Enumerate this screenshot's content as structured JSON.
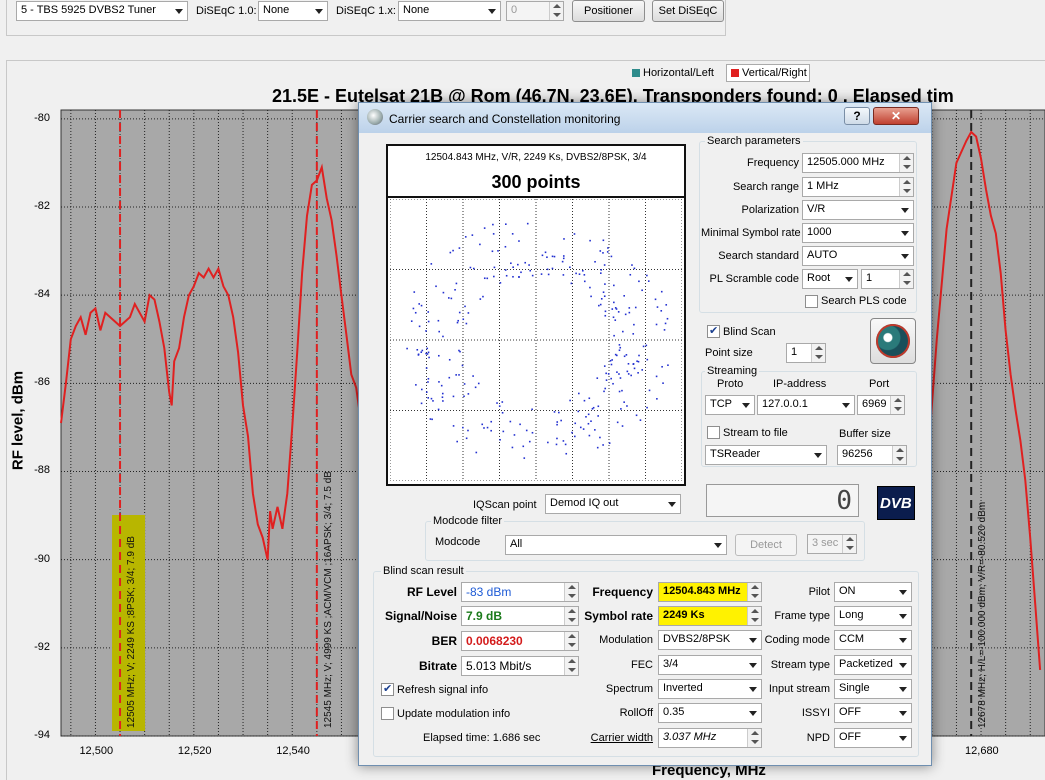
{
  "toolbar": {
    "tuner": "5 - TBS 5925 DVBS2 Tuner",
    "diseqc10_label": "DiSEqC 1.0:",
    "diseqc10_value": "None",
    "diseqc1x_label": "DiSEqC 1.x:",
    "diseqc1x_value": "None",
    "diseqc_num": "0",
    "positioner": "Positioner",
    "set_diseqc": "Set DiSEqC"
  },
  "legend": {
    "h": "Horizontal/Left",
    "v": "Vertical/Right",
    "h_color": "#2e8b8b",
    "v_color": "#e02020"
  },
  "chart_data": {
    "type": "line",
    "title": "21.5E - Eutelsat 21B  @ Rom (46.7N, 23.6E), Transponders found: 0 , Elapsed tim",
    "xlabel": "Frequency, MHz",
    "ylabel": "RF level, dBm",
    "xlim": [
      12493,
      12693
    ],
    "ylim": [
      -94,
      -79.8
    ],
    "grid": true,
    "y_ticks": [
      "-80",
      "-82",
      "-84",
      "-86",
      "-88",
      "-90",
      "-92",
      "-94"
    ],
    "x_ticks": [
      "12,500",
      "12,520",
      "12,540",
      "12,680"
    ],
    "x_tick_values": [
      12500,
      12520,
      12540,
      12680
    ],
    "y_tick_values": [
      -80,
      -82,
      -84,
      -86,
      -88,
      -90,
      -92,
      -94
    ],
    "series": [
      {
        "name": "Vertical/Right",
        "color": "#e02020",
        "points": [
          [
            12493,
            -86.9
          ],
          [
            12494,
            -86
          ],
          [
            12495,
            -85
          ],
          [
            12496,
            -84.7
          ],
          [
            12497,
            -84.5
          ],
          [
            12498,
            -84.9
          ],
          [
            12499,
            -84.4
          ],
          [
            12500,
            -84.3
          ],
          [
            12501,
            -84.8
          ],
          [
            12502,
            -84.4
          ],
          [
            12503,
            -84.5
          ],
          [
            12504,
            -84.6
          ],
          [
            12505,
            -84.7
          ],
          [
            12506,
            -84.6
          ],
          [
            12507,
            -84.5
          ],
          [
            12508,
            -84.2
          ],
          [
            12509,
            -84.4
          ],
          [
            12510,
            -84.6
          ],
          [
            12511,
            -84.0
          ],
          [
            12512,
            -84.1
          ],
          [
            12513,
            -84.6
          ],
          [
            12514,
            -85.2
          ],
          [
            12515,
            -86.2
          ],
          [
            12515.5,
            -86.5
          ],
          [
            12516,
            -85.5
          ],
          [
            12517,
            -85.2
          ],
          [
            12518,
            -84.5
          ],
          [
            12519,
            -84.0
          ],
          [
            12520,
            -83.8
          ],
          [
            12521,
            -83.5
          ],
          [
            12522,
            -83.6
          ],
          [
            12523,
            -83.4
          ],
          [
            12524,
            -83.6
          ],
          [
            12525,
            -83.4
          ],
          [
            12526,
            -83.8
          ],
          [
            12527,
            -84.0
          ],
          [
            12528,
            -84.5
          ],
          [
            12529,
            -85.3
          ],
          [
            12530,
            -86.5
          ],
          [
            12531,
            -87.2
          ],
          [
            12532,
            -88.5
          ],
          [
            12533,
            -89.2
          ],
          [
            12534,
            -89.5
          ],
          [
            12535,
            -90.0
          ],
          [
            12535.5,
            -88.9
          ],
          [
            12536,
            -89.3
          ],
          [
            12537,
            -88.8
          ],
          [
            12538,
            -89.3
          ],
          [
            12539,
            -88.5
          ],
          [
            12540,
            -87.0
          ],
          [
            12541,
            -85.3
          ],
          [
            12542,
            -83.5
          ],
          [
            12543,
            -82.2
          ],
          [
            12544,
            -81.5
          ],
          [
            12545,
            -81.4
          ],
          [
            12546,
            -81.1
          ],
          [
            12547,
            -81.8
          ],
          [
            12548,
            -82.3
          ],
          [
            12549,
            -83.1
          ],
          [
            12550,
            -84.0
          ],
          [
            12551,
            -84.9
          ],
          [
            12552,
            -85.8
          ],
          [
            12553,
            -86.1
          ],
          [
            12554,
            -86.9
          ],
          [
            12555,
            -86.4
          ],
          [
            12556,
            -86.0
          ],
          [
            12557,
            -86.9
          ],
          [
            12665,
            -92.0
          ],
          [
            12667,
            -90.5
          ],
          [
            12669,
            -88.0
          ],
          [
            12671,
            -85.0
          ],
          [
            12673,
            -82.5
          ],
          [
            12675,
            -81.0
          ],
          [
            12677,
            -80.5
          ],
          [
            12678,
            -80.3
          ],
          [
            12679,
            -80.4
          ],
          [
            12680,
            -80.9
          ],
          [
            12681,
            -81.6
          ],
          [
            12682,
            -82.2
          ],
          [
            12683,
            -82.6
          ],
          [
            12684,
            -83.5
          ],
          [
            12685,
            -84.8
          ],
          [
            12686,
            -85.8
          ],
          [
            12687,
            -86.6
          ],
          [
            12688,
            -87.3
          ],
          [
            12689,
            -88.2
          ],
          [
            12690,
            -89.5
          ],
          [
            12691,
            -91.0
          ],
          [
            12692,
            -92.5
          ]
        ]
      }
    ],
    "markers": [
      {
        "x": 12505,
        "label": "12505 MHz; V; 2249 KS ;8PSK; 3/4; 7.9 dB",
        "highlight": true
      },
      {
        "x": 12545,
        "label": "12545 MHz; V; 4999 KS ;ACM/VCM ;16APSK; 3/4; 7.5 dB",
        "highlight": false
      },
      {
        "x": 12678,
        "label": "12678 MHz; H/L=-100.000 dBm; V/R=-80.520 dBm",
        "highlight": false
      }
    ]
  },
  "dialog": {
    "title": "Carrier search and Constellation monitoring",
    "help": "?",
    "close": "✕",
    "const_info": "12504.843 MHz, V/R, 2249 Ks, DVBS2/8PSK, 3/4",
    "const_points": "300 points",
    "iqscan_label": "IQScan point",
    "iqscan_value": "Demod IQ out",
    "modcode_group": "Modcode filter",
    "modcode_label": "Modcode",
    "modcode_value": "All",
    "detect": "Detect",
    "detect_time": "3 sec",
    "lcd_value": "0",
    "dvb_logo": "DVB",
    "sp": {
      "group": "Search parameters",
      "freq_label": "Frequency",
      "freq": "12505.000 MHz",
      "range_label": "Search range",
      "range": "1 MHz",
      "pol_label": "Polarization",
      "pol": "V/R",
      "minsr_label": "Minimal Symbol rate",
      "minsr": "1000",
      "std_label": "Search standard",
      "std": "AUTO",
      "pls_label": "PL Scramble code",
      "pls_type": "Root",
      "pls_val": "1",
      "search_pls": "Search PLS code",
      "blind": "Blind Scan",
      "pointsize_label": "Point size",
      "pointsize": "1"
    },
    "streaming": {
      "group": "Streaming",
      "proto_label": "Proto",
      "proto": "TCP",
      "ip_label": "IP-address",
      "ip": "127.0.0.1",
      "port_label": "Port",
      "port": "6969",
      "to_file": "Stream to file",
      "buffer_label": "Buffer size",
      "buffer": "96256",
      "reader": "TSReader"
    },
    "result": {
      "group": "Blind scan result",
      "rf_label": "RF Level",
      "rf": "-83 dBm",
      "snr_label": "Signal/Noise",
      "snr": "7.9 dB",
      "ber_label": "BER",
      "ber": "0.0068230",
      "bitrate_label": "Bitrate",
      "bitrate": "5.013 Mbit/s",
      "refresh": "Refresh signal info",
      "update_mod": "Update modulation info",
      "elapsed": "Elapsed time: 1.686 sec",
      "freq_label": "Frequency",
      "freq": "12504.843 MHz",
      "sr_label": "Symbol rate",
      "sr": "2249 Ks",
      "mod_label": "Modulation",
      "mod": "DVBS2/8PSK",
      "fec_label": "FEC",
      "fec": "3/4",
      "spec_label": "Spectrum",
      "spec": "Inverted",
      "rolloff_label": "RollOff",
      "rolloff": "0.35",
      "cw_label": "Carrier width",
      "cw": "3.037 MHz",
      "pilot_label": "Pilot",
      "pilot": "ON",
      "frame_label": "Frame type",
      "frame": "Long",
      "coding_label": "Coding mode",
      "coding": "CCM",
      "stype_label": "Stream type",
      "stype": "Packetized",
      "input_label": "Input stream",
      "input": "Single",
      "issyi_label": "ISSYI",
      "issyi": "OFF",
      "npd_label": "NPD",
      "npd": "OFF"
    }
  }
}
